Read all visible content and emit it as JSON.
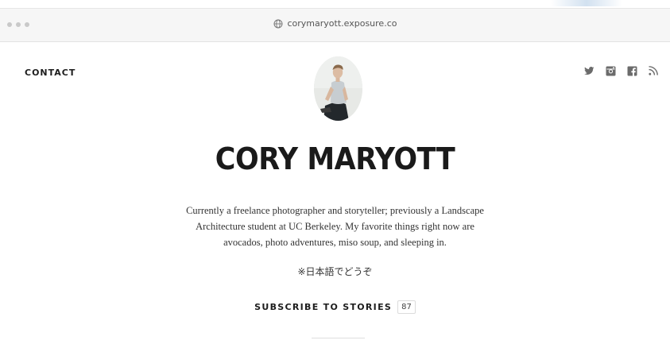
{
  "browser": {
    "url": "corymaryott.exposure.co"
  },
  "nav": {
    "contact_label": "CONTACT"
  },
  "social": [
    {
      "name": "twitter-icon"
    },
    {
      "name": "instagram-icon"
    },
    {
      "name": "facebook-icon"
    },
    {
      "name": "rss-icon"
    }
  ],
  "profile": {
    "name": "CORY MARYOTT",
    "bio": "Currently a freelance photographer and storyteller; previously a Landscape Architecture student at UC Berkeley. My favorite things right now are avocados, photo adventures, miso soup, and sleeping in.",
    "japanese_note": "※日本語でどうぞ"
  },
  "subscribe": {
    "label": "SUBSCRIBE TO STORIES",
    "count": "87"
  },
  "colors": {
    "text": "#1d1d1d",
    "icon": "#6b6b6b",
    "titlebar": "#f6f6f6"
  }
}
